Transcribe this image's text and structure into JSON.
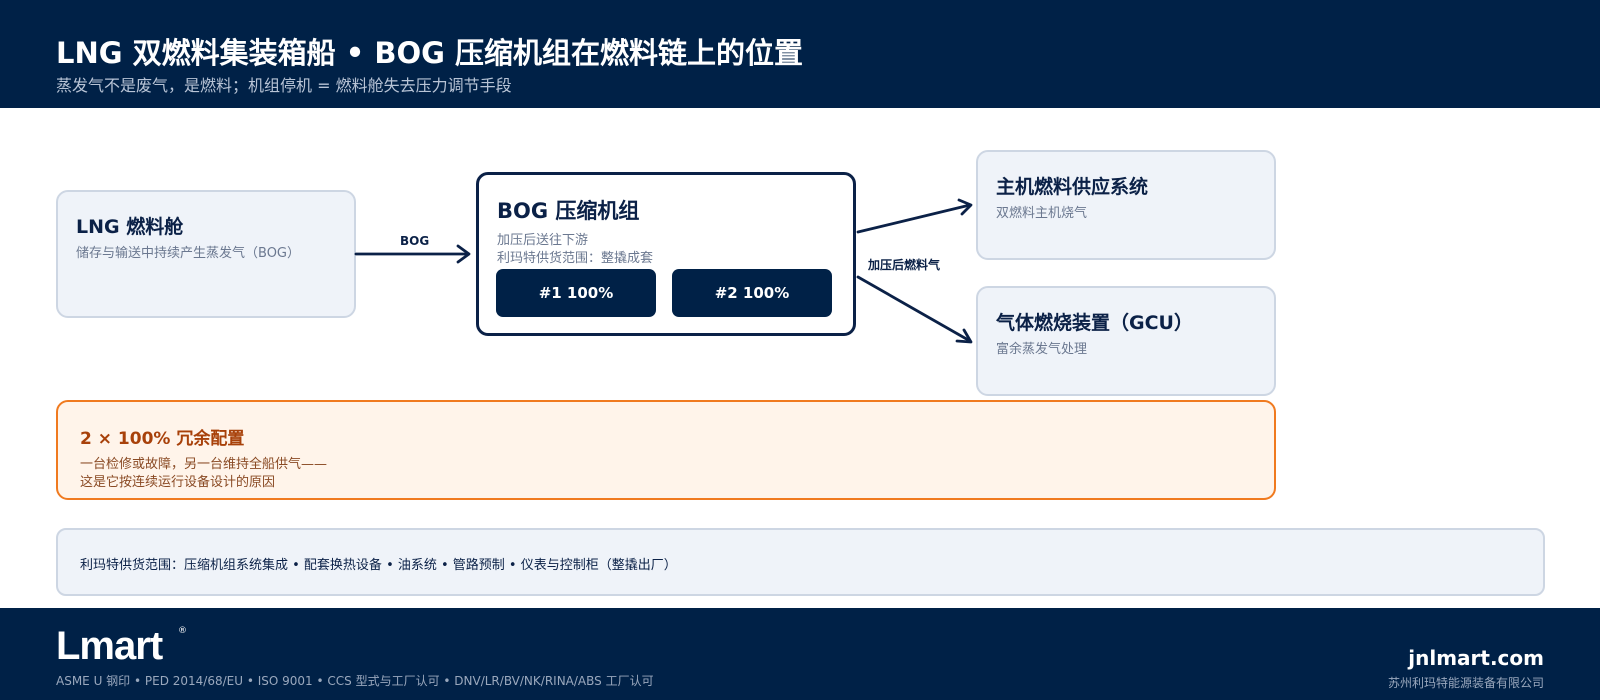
{
  "header": {
    "title": "LNG 双燃料集装箱船 • BOG 压缩机组在燃料链上的位置",
    "subtitle": "蒸发气不是废气，是燃料；机组停机 = 燃料舱失去压力调节手段"
  },
  "tank": {
    "title": "LNG 燃料舱",
    "subtitle": "储存与输送中持续产生蒸发气（BOG）"
  },
  "compressor": {
    "title": "BOG 压缩机组",
    "line1": "加压后送往下游",
    "line2": "利玛特供货范围：整撬成套",
    "units": [
      "#1  100%",
      "#2  100%"
    ]
  },
  "engine": {
    "title": "主机燃料供应系统",
    "subtitle": "双燃料主机烧气"
  },
  "gcu": {
    "title": "气体燃烧装置（GCU）",
    "subtitle": "富余蒸发气处理"
  },
  "flows": {
    "bog_label": "BOG",
    "pressurized_label": "加压后燃料气"
  },
  "redundancy": {
    "title": "2 × 100% 冗余配置",
    "line1": "一台检修或故障，另一台维持全船供气——",
    "line2": "这是它按连续运行设备设计的原因"
  },
  "scope": {
    "text": "利玛特供货范围：压缩机组系统集成 • 配套换热设备 • 油系统 • 管路预制 • 仪表与控制柜（整撬出厂）"
  },
  "footer": {
    "logo": "Lmart",
    "logo_mark": "®",
    "certs": "ASME U 钢印 • PED 2014/68/EU • ISO 9001 • CCS 型式与工厂认可 • DNV/LR/BV/NK/RINA/ABS 工厂认可",
    "site": "jnlmart.com",
    "company": "苏州利玛特能源装备有限公司"
  },
  "colors": {
    "navy": "#002147",
    "card_bg": "#eff3f9",
    "accent_orange": "#f07a1f"
  }
}
